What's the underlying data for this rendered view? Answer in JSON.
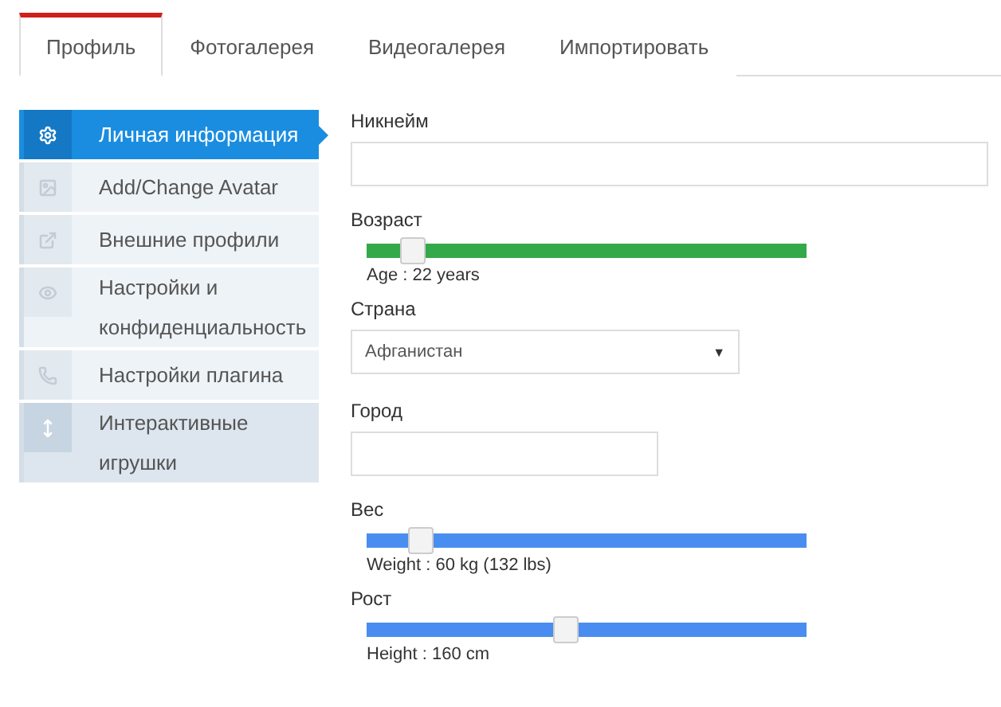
{
  "tabs": [
    {
      "label": "Профиль",
      "selected": true
    },
    {
      "label": "Фотогалерея",
      "selected": false
    },
    {
      "label": "Видеогалерея",
      "selected": false
    },
    {
      "label": "Импортировать",
      "selected": false
    }
  ],
  "sidebar": {
    "items": [
      {
        "label": "Личная информация",
        "selected": true,
        "emphasis": false
      },
      {
        "label": "Add/Change Avatar",
        "selected": false,
        "emphasis": false
      },
      {
        "label": "Внешние профили",
        "selected": false,
        "emphasis": false
      },
      {
        "label": "Настройки и конфиденциальность",
        "selected": false,
        "emphasis": false
      },
      {
        "label": "Настройки плагина",
        "selected": false,
        "emphasis": false
      },
      {
        "label": "Интерактивные игрушки",
        "selected": false,
        "emphasis": true
      }
    ]
  },
  "form": {
    "fields": [
      {
        "kind": "widetext",
        "label": "Никнейм"
      },
      {
        "kind": "slider",
        "label": "Возраст",
        "level": 0.1,
        "color": "#33a94a",
        "reading": "Age : 22 years"
      },
      {
        "kind": "select",
        "label": "Страна",
        "value": "Афганистан",
        "caret": "▼"
      },
      {
        "kind": "shorttext",
        "label": "Город"
      },
      {
        "kind": "slider",
        "label": "Вес",
        "level": 0.12,
        "color": "#4a8df0",
        "reading": "Weight : 60 kg (132 lbs)"
      },
      {
        "kind": "slider",
        "label": "Рост",
        "level": 0.45,
        "color": "#4a8df0",
        "reading": "Height : 160 cm"
      }
    ]
  }
}
